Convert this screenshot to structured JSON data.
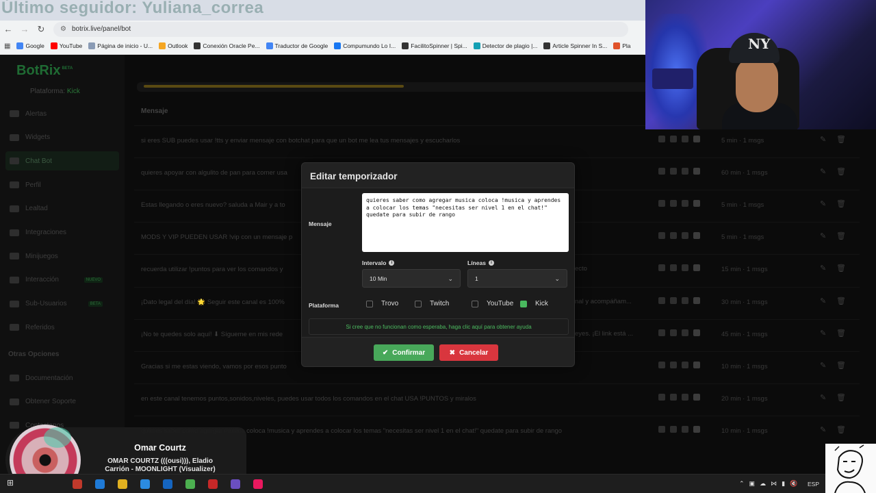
{
  "overlay": {
    "follower_text": "Último seguidor: Yuliana_correa"
  },
  "browser": {
    "url": "botrix.live/panel/bot",
    "bookmarks": [
      {
        "label": "Google",
        "color": "#4285f4"
      },
      {
        "label": "YouTube",
        "color": "#ff0000"
      },
      {
        "label": "Página de inicio - U...",
        "color": "#8a9bb5"
      },
      {
        "label": "Outlook",
        "color": "#f5a623"
      },
      {
        "label": "Conexión Oracle Pe...",
        "color": "#333333"
      },
      {
        "label": "Traductor de Google",
        "color": "#4285f4"
      },
      {
        "label": "Compumundo Lo I...",
        "color": "#1877f2"
      },
      {
        "label": "FacilitoSpinner | Spi...",
        "color": "#333333"
      },
      {
        "label": "Detector de plagio |...",
        "color": "#14a0b4"
      },
      {
        "label": "Article Spinner In S...",
        "color": "#333333"
      },
      {
        "label": "Pla",
        "color": "#e0522a"
      }
    ]
  },
  "sidebar": {
    "logo": "BotRix",
    "logo_badge": "BETA",
    "platform_label": "Plataforma:",
    "platform_value": "Kick",
    "items": [
      {
        "label": "Alertas",
        "active": false,
        "badge": ""
      },
      {
        "label": "Widgets",
        "active": false,
        "badge": ""
      },
      {
        "label": "Chat Bot",
        "active": true,
        "badge": ""
      },
      {
        "label": "Perfil",
        "active": false,
        "badge": ""
      },
      {
        "label": "Lealtad",
        "active": false,
        "badge": ""
      },
      {
        "label": "Integraciones",
        "active": false,
        "badge": ""
      },
      {
        "label": "Minijuegos",
        "active": false,
        "badge": ""
      },
      {
        "label": "Interacción",
        "active": false,
        "badge": "NUEVO"
      },
      {
        "label": "Sub-Usuarios",
        "active": false,
        "badge": "BETA"
      },
      {
        "label": "Referidos",
        "active": false,
        "badge": ""
      }
    ],
    "section_title": "Otras Opciones",
    "other_items": [
      {
        "label": "Documentación"
      },
      {
        "label": "Obtener Soporte"
      },
      {
        "label": "Contactanos"
      }
    ]
  },
  "table": {
    "header": "Mensaje",
    "rows": [
      {
        "text": "si eres SUB puedes usar !tts y enviar mensaje con botchat para que un bot me lea tus mensajes y escucharlos",
        "interval": "5 min · 1 msgs"
      },
      {
        "text": "quieres apoyar con algulito de pan para comer usa",
        "interval": "60 min · 1 msgs"
      },
      {
        "text": "Estas llegando o eres nuevo? saluda a Mair y a to",
        "interval": "5 min · 1 msgs"
      },
      {
        "text": "MODS Y VIP PUEDEN USAR !vip con un mensaje p",
        "interval": "5 min · 1 msgs"
      },
      {
        "text": "recuerda utilizar !puntos para ver los comandos y",
        "interval": "15 min · 1 msgs"
      },
      {
        "text": "¡Dato legal del día! 🌟 Seguir este canal es 100%",
        "interval": "30 min · 1 msgs"
      },
      {
        "text": "¡No te quedes solo aquí! ⬇ Sígueme en mis rede",
        "interval": "45 min · 1 msgs"
      },
      {
        "text": "Gracias si me estas viendo, vamos por esos punto",
        "interval": "10 min · 1 msgs"
      },
      {
        "text": "en este canal tenemos puntos,sonidos,niveles, puedes usar todos los comandos en el chat USA !PUNTOS y miralos",
        "interval": "20 min · 1 msgs"
      },
      {
        "text": "quieres saber como agregar musica coloca !musica y aprendes a colocar los temas \"necesitas ser nivel 1 en el chat!\" quedate para subir de rango",
        "interval": "10 min · 1 msgs"
      }
    ],
    "row_tails": [
      {
        "index": 4,
        "text": "ecto"
      },
      {
        "index": 5,
        "text": "nal y acompáñam..."
      },
      {
        "index": 6,
        "text": "eyes. ¡El link está ..."
      }
    ]
  },
  "modal": {
    "title": "Editar temporizador",
    "message_label": "Mensaje",
    "message_value": "quieres saber como agregar musica coloca !musica y aprendes a colocar los temas \"necesitas ser nivel 1 en el chat!\" quedate para subir de rango",
    "interval_label": "Intervalo",
    "interval_value": "10 Min",
    "lines_label": "Líneas",
    "lines_value": "1",
    "platform_label": "Plataforma",
    "platforms": [
      {
        "label": "Trovo",
        "checked": false
      },
      {
        "label": "Twitch",
        "checked": false
      },
      {
        "label": "YouTube",
        "checked": false
      },
      {
        "label": "Kick",
        "checked": true
      }
    ],
    "help_text": "Si cree que no funcionan como esperaba, haga clic aquí para obtener ayuda",
    "confirm_label": "Confirmar",
    "cancel_label": "Cancelar"
  },
  "now_playing": {
    "artist": "Omar Courtz",
    "track": "OMAR COURTZ (((ousi))), Eladio Carrión - MOONLIGHT (Visualizer)"
  },
  "taskbar": {
    "language": "ESP",
    "apps": [
      {
        "name": "app-1",
        "color": "#c0392b"
      },
      {
        "name": "edge",
        "color": "#1f7ad6"
      },
      {
        "name": "explorer",
        "color": "#e0b020"
      },
      {
        "name": "store",
        "color": "#2b8be0"
      },
      {
        "name": "outlook",
        "color": "#1565c0"
      },
      {
        "name": "chrome",
        "color": "#4caf50"
      },
      {
        "name": "app-7",
        "color": "#c62828"
      },
      {
        "name": "app-8",
        "color": "#6a4fc0"
      },
      {
        "name": "tiktok",
        "color": "#e9185e"
      }
    ]
  }
}
